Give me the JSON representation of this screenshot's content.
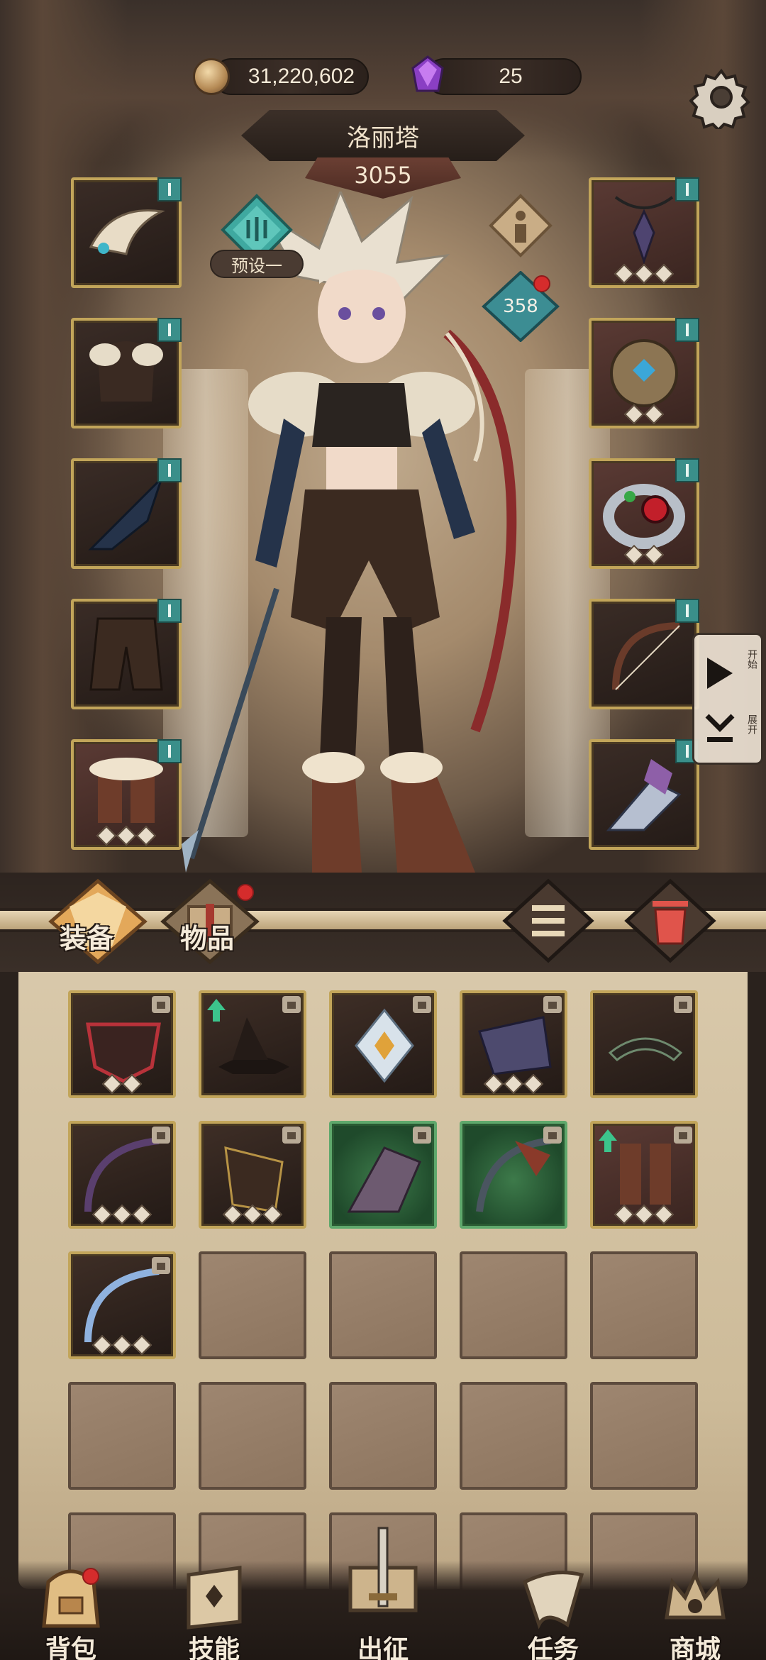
{
  "currency": {
    "gold": "31,220,602",
    "gems": "25"
  },
  "hero": {
    "name": "洛丽塔",
    "power": "3055",
    "preset_label": "预设一",
    "level": "358"
  },
  "side_panel": {
    "start_label": "开始",
    "expand_label": "展开"
  },
  "tabs": {
    "equipment": "装备",
    "items": "物品"
  },
  "nav": {
    "items": [
      {
        "label": "背包"
      },
      {
        "label": "技能"
      },
      {
        "label": "出征"
      },
      {
        "label": "任务"
      },
      {
        "label": "商城"
      }
    ]
  },
  "colors": {
    "gold_frame": "#c2a55a",
    "teal_badge": "#3a8f8a",
    "notification_red": "#d52c2c",
    "rare_green": "#5fa86c"
  }
}
